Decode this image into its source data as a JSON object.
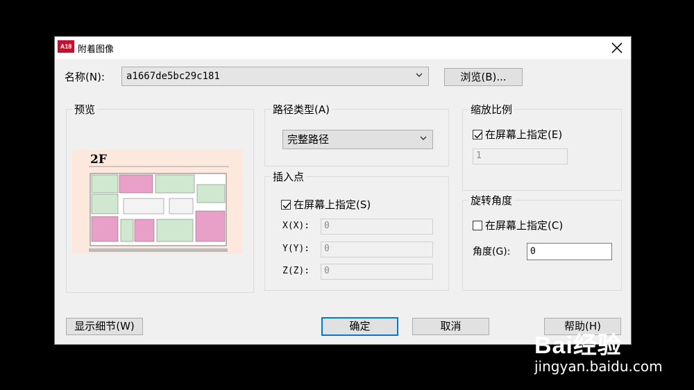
{
  "window": {
    "title": "附着图像",
    "app_icon_text": "A18"
  },
  "name_row": {
    "label": "名称(N):",
    "value": "a1667de5bc29c181",
    "browse_button": "浏览(B)..."
  },
  "preview": {
    "title": "预览",
    "floor_label": "2F"
  },
  "path_type": {
    "title": "路径类型(A)",
    "selected": "完整路径"
  },
  "insertion_point": {
    "title": "插入点",
    "specify_on_screen": "在屏幕上指定(S)",
    "specify_checked": true,
    "x_label": "X(X):",
    "x_value": "0",
    "y_label": "Y(Y):",
    "y_value": "0",
    "z_label": "Z(Z):",
    "z_value": "0"
  },
  "scale": {
    "title": "缩放比例",
    "specify_on_screen": "在屏幕上指定(E)",
    "specify_checked": true,
    "value": "1"
  },
  "rotation": {
    "title": "旋转角度",
    "specify_on_screen": "在屏幕上指定(C)",
    "specify_checked": false,
    "angle_label": "角度(G):",
    "angle_value": "0"
  },
  "buttons": {
    "details": "显示细节(W)",
    "ok": "确定",
    "cancel": "取消",
    "help": "帮助(H)"
  },
  "watermark": {
    "logo": "Bai经验",
    "url": "jingyan.baidu.com"
  }
}
